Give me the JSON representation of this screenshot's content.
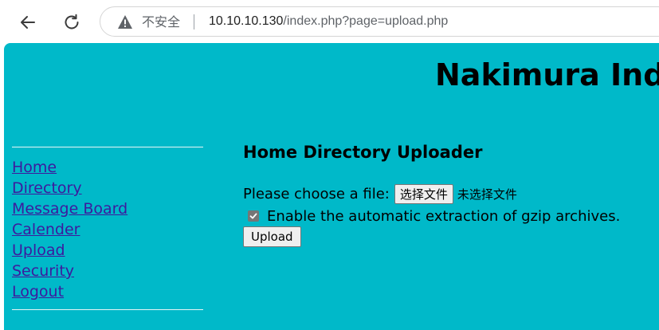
{
  "browser": {
    "security_label": "不安全",
    "url_host": "10.10.10.130",
    "url_path": "/index.php?page=upload.php"
  },
  "page": {
    "site_title": "Nakimura Indu",
    "menu": [
      {
        "label": "Home"
      },
      {
        "label": "Directory"
      },
      {
        "label": "Message Board"
      },
      {
        "label": "Calender"
      },
      {
        "label": "Upload"
      },
      {
        "label": "Security"
      },
      {
        "label": "Logout"
      }
    ],
    "uploader": {
      "heading": "Home Directory Uploader",
      "file_prompt": "Please choose a file:",
      "choose_button": "选择文件",
      "no_file_text": "未选择文件",
      "gzip_checkbox_label": "Enable the automatic extraction of gzip archives.",
      "gzip_checked": true,
      "upload_button": "Upload"
    }
  },
  "colors": {
    "page_background": "#00b9c9",
    "link": "#3d1a9e"
  },
  "icons": {
    "back": "arrow-left",
    "reload": "refresh",
    "security": "warning-triangle",
    "checkbox": "checkmark"
  }
}
